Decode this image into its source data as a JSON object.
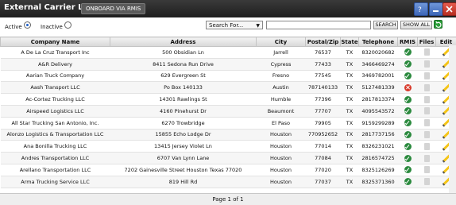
{
  "window": {
    "title": "External Carrier List",
    "onboard_label": "ONBOARD VIA RMIS"
  },
  "filters": {
    "active_label": "Active",
    "inactive_label": "Inactive",
    "search_for": "Search For...",
    "search_value": "",
    "search_label": "SEARCH",
    "show_all_label": "SHOW ALL"
  },
  "columns": [
    "Company Name",
    "Address",
    "City",
    "Postal/Zip",
    "State",
    "Telephone",
    "RMIS",
    "Files",
    "Edit"
  ],
  "rows": [
    {
      "company": "A De La Cruz Transport Inc",
      "address": "500 Obsidian Ln",
      "city": "Jarrell",
      "zip": "76537",
      "state": "TX",
      "phone": "8320020682",
      "rmis": "ok"
    },
    {
      "company": "A&R Delivery",
      "address": "8411 Sedona Run Drive",
      "city": "Cypress",
      "zip": "77433",
      "state": "TX",
      "phone": "3466469274",
      "rmis": "ok"
    },
    {
      "company": "Aarian Truck Company",
      "address": "629 Evergreen St",
      "city": "Fresno",
      "zip": "77545",
      "state": "TX",
      "phone": "3469782001",
      "rmis": "ok"
    },
    {
      "company": "Aash Transport LLC",
      "address": "Po Box 140133",
      "city": "Austin",
      "zip": "787140133",
      "state": "TX",
      "phone": "5127481339",
      "rmis": "bad"
    },
    {
      "company": "Ac-Cortez Trucking LLC",
      "address": "14301 Rawlings St",
      "city": "Humble",
      "zip": "77396",
      "state": "TX",
      "phone": "2817813374",
      "rmis": "ok"
    },
    {
      "company": "Airspeed Logistics LLC",
      "address": "4160 Pinehurst Dr",
      "city": "Beaumont",
      "zip": "77707",
      "state": "TX",
      "phone": "4095543572",
      "rmis": "ok"
    },
    {
      "company": "All Star Trucking San Antonio, Inc.",
      "address": "6270 Trowbridge",
      "city": "El Paso",
      "zip": "79905",
      "state": "TX",
      "phone": "9159299289",
      "rmis": "ok"
    },
    {
      "company": "Alonzo Logistics & Transportation LLC",
      "address": "15855 Echo Lodge Dr",
      "city": "Houston",
      "zip": "770952652",
      "state": "TX",
      "phone": "2817737156",
      "rmis": "ok"
    },
    {
      "company": "Ana Bonilla Trucking LLC",
      "address": "13415 Jersey Violet Ln",
      "city": "Houston",
      "zip": "77014",
      "state": "TX",
      "phone": "8326231021",
      "rmis": "ok"
    },
    {
      "company": "Andres Transportation LLC",
      "address": "6707 Van Lynn Lane",
      "city": "Houston",
      "zip": "77084",
      "state": "TX",
      "phone": "2816574725",
      "rmis": "ok"
    },
    {
      "company": "Arellano Transportation LLC",
      "address": "7202 Gainesville Street Houston Texas 77020",
      "city": "Houston",
      "zip": "77020",
      "state": "TX",
      "phone": "8325126269",
      "rmis": "ok"
    },
    {
      "company": "Arma Trucking Service LLC",
      "address": "819 Hill Rd",
      "city": "Houston",
      "zip": "77037",
      "state": "TX",
      "phone": "8325371360",
      "rmis": "ok"
    }
  ],
  "pagination": {
    "label": "Page 1 of 1"
  }
}
